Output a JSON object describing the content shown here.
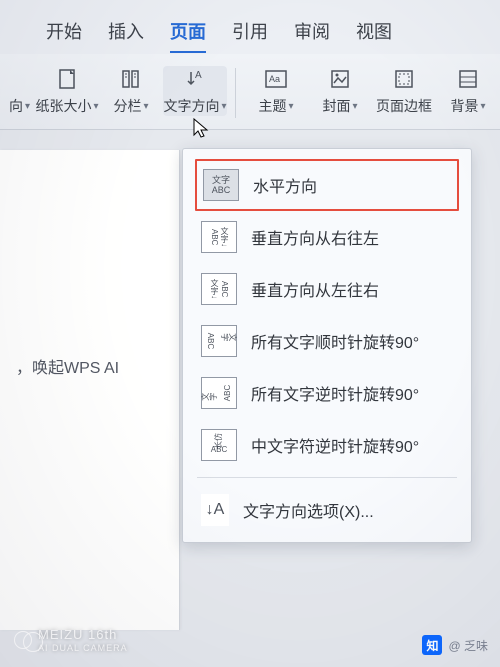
{
  "tabs": {
    "t0": "开始",
    "t1": "插入",
    "t2": "页面",
    "t3": "引用",
    "t4": "审阅",
    "t5": "视图"
  },
  "ribbon": {
    "r0_label": "向",
    "r1_label": "纸张大小",
    "r2_label": "分栏",
    "r3_label": "文字方向",
    "r4_label": "主题",
    "r5_label": "封面",
    "r6_label": "页面边框",
    "r7_label": "背景"
  },
  "doc_hint": "，唤起WPS AI",
  "menu": {
    "m0": "水平方向",
    "m1": "垂直方向从右往左",
    "m2": "垂直方向从左往右",
    "m3": "所有文字顺时针旋转90°",
    "m4": "所有文字逆时针旋转90°",
    "m5": "中文字符逆时针旋转90°",
    "m6": "文字方向选项(X)..."
  },
  "thumbs": {
    "t0a": "文字",
    "t0b": "ABC",
    "vert": "文\n字\n↓",
    "abcv": "A\nB\nC",
    "rot": "ABC",
    "opt": "↓A"
  },
  "watermark": {
    "brand": "MEIZU 16th",
    "sub": "AI DUAL CAMERA",
    "zhihu_logo": "知",
    "zhihu_user": "@ 乏味"
  }
}
